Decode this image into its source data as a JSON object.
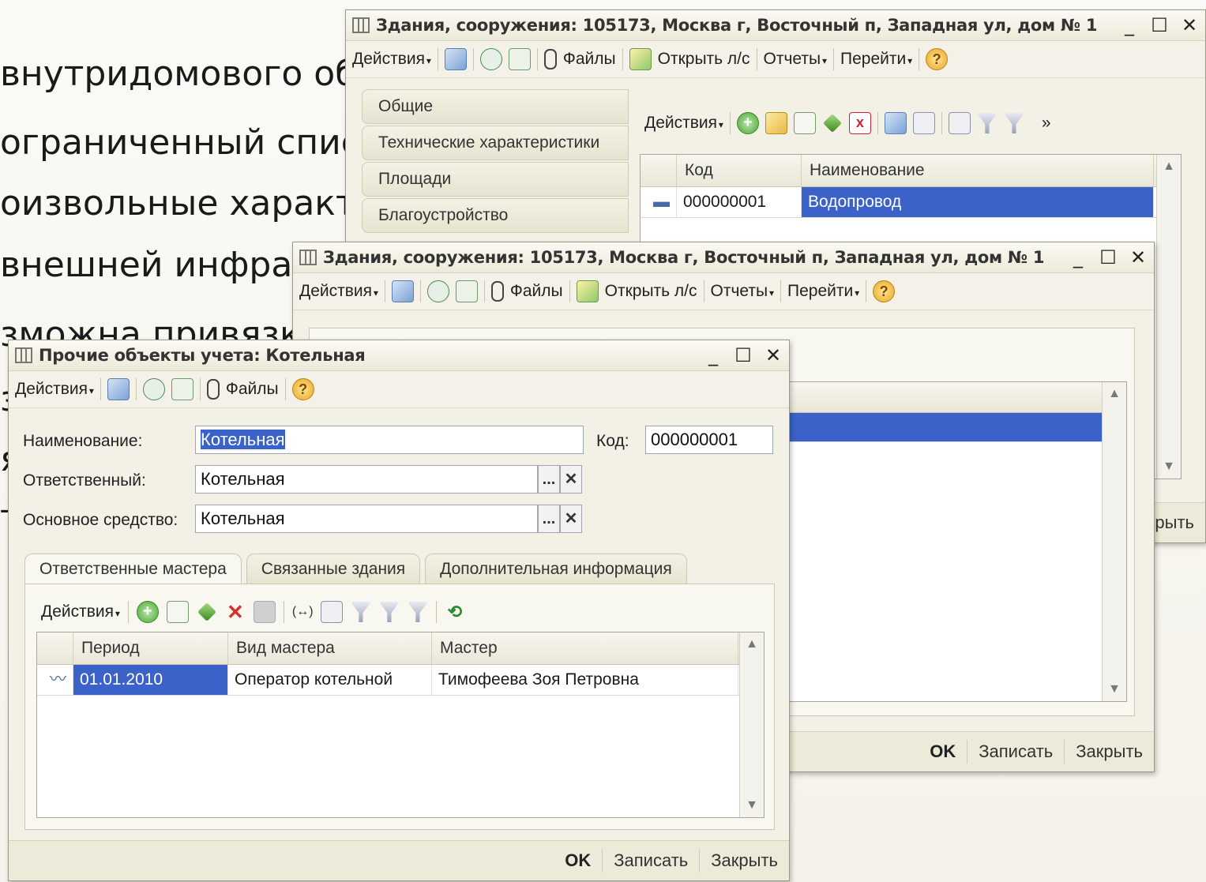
{
  "slide": {
    "lines": [
      "внутридомового об",
      "ограниченный списо",
      "оизвольные характе",
      "внешней инфра",
      "зможна привязка",
      "з",
      "я",
      "т"
    ]
  },
  "win_back": {
    "title": "Здания, сооружения: 105173, Москва г, Восточный п, Западная ул, дом № 1",
    "controls": {
      "min": "_",
      "max": "☐",
      "close": "✕"
    },
    "toolbar": {
      "actions": "Действия",
      "files": "Файлы",
      "open_ls": "Открыть л/с",
      "reports": "Отчеты",
      "goto": "Перейти",
      "help": "?"
    },
    "side_tabs": [
      "Общие",
      "Технические характеристики",
      "Площади",
      "Благоустройство"
    ],
    "inner_toolbar": {
      "actions": "Действия",
      "more": "»"
    },
    "grid": {
      "headers": [
        "Код",
        "Наименование"
      ],
      "rows": [
        {
          "code": "000000001",
          "name": "Водопровод"
        }
      ]
    },
    "footer": {
      "close": "рыть"
    }
  },
  "win_mid": {
    "title": "Здания, сооружения: 105173, Москва г, Восточный п, Западная ул, дом № 1",
    "controls": {
      "min": "_",
      "max": "☐",
      "close": "✕"
    },
    "toolbar": {
      "actions": "Действия",
      "files": "Файлы",
      "open_ls": "Открыть л/с",
      "reports": "Отчеты",
      "goto": "Перейти",
      "help": "?"
    },
    "footer": {
      "ok": "OK",
      "save": "Записать",
      "close": "Закрыть"
    }
  },
  "win_front": {
    "title": "Прочие объекты учета: Котельная",
    "controls": {
      "min": "_",
      "max": "☐",
      "close": "✕"
    },
    "toolbar": {
      "actions": "Действия",
      "files": "Файлы",
      "help": "?"
    },
    "fields": {
      "name_label": "Наименование:",
      "name_value": "Котельная",
      "code_label": "Код:",
      "code_value": "000000001",
      "responsible_label": "Ответственный:",
      "responsible_value": "Котельная",
      "asset_label": "Основное средство:",
      "asset_value": "Котельная",
      "select_btn": "...",
      "clear_btn": "✕"
    },
    "tabs": [
      "Ответственные мастера",
      "Связанные здания",
      "Дополнительная информация"
    ],
    "panel_toolbar": {
      "actions": "Действия"
    },
    "grid": {
      "headers": [
        "Период",
        "Вид мастера",
        "Мастер"
      ],
      "rows": [
        {
          "period": "01.01.2010",
          "kind": "Оператор котельной",
          "master": "Тимофеева Зоя Петровна"
        }
      ]
    },
    "footer": {
      "ok": "OK",
      "save": "Записать",
      "close": "Закрыть"
    }
  }
}
